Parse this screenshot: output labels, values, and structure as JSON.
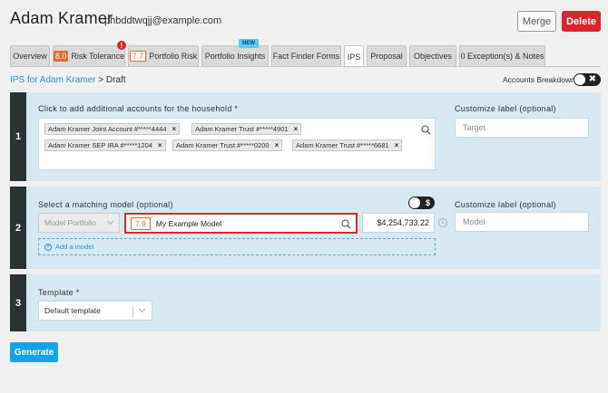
{
  "header": {
    "client_name": "Adam Kramer",
    "email": "phbddtwqjj@example.com",
    "merge_label": "Merge",
    "delete_label": "Delete"
  },
  "tabs": [
    {
      "label": "Overview"
    },
    {
      "label": "Risk Tolerance",
      "score": "8.0",
      "alert": "!"
    },
    {
      "label": "Portfolio Risk",
      "score": "7.7"
    },
    {
      "label": "Portfolio Insights",
      "badge": "NEW"
    },
    {
      "label": "Fact Finder Forms"
    },
    {
      "label": "IPS",
      "active": true
    },
    {
      "label": "Proposal"
    },
    {
      "label": "Objectives"
    },
    {
      "label": "0 Exception(s) & Notes"
    }
  ],
  "breadcrumb": {
    "link": "IPS for Adam Kramer",
    "separator": ">",
    "current": "Draft"
  },
  "accounts_breakdown": {
    "label": "Accounts Breakdown",
    "toggle_glyph": "✖"
  },
  "step1": {
    "number": "1",
    "label": "Click to add additional accounts for the household *",
    "accounts": [
      "Adam Kramer Joint Account #*****4444",
      "Adam Kramer Trust #*****4901",
      "Adam Kramer SEP IRA #*****1204",
      "Adam Kramer Trust #*****0200",
      "Adam Kramer Trust #*****6681"
    ],
    "chip_remove": "×",
    "custom_label_title": "Customize label (optional)",
    "custom_label_placeholder": "Target"
  },
  "step2": {
    "number": "2",
    "label": "Select a matching model (optional)",
    "toggle_glyph": "$",
    "model_type": "Model Portfolio",
    "model_score": "7.9",
    "model_name": "My Example Model",
    "amount": "$4,254,733.22",
    "clear_glyph": "×",
    "add_model_label": "Add a model",
    "add_model_glyph": "+",
    "custom_label_title": "Customize label (optional)",
    "custom_label_placeholder": "Model"
  },
  "step3": {
    "number": "3",
    "label": "Template *",
    "template_value": "Default template"
  },
  "generate_label": "Generate",
  "colors": {
    "accent": "#14a5e6",
    "danger": "#d9262c",
    "score": "#e06a2f",
    "panel": "#d6e9f3",
    "step": "#2a3236"
  }
}
